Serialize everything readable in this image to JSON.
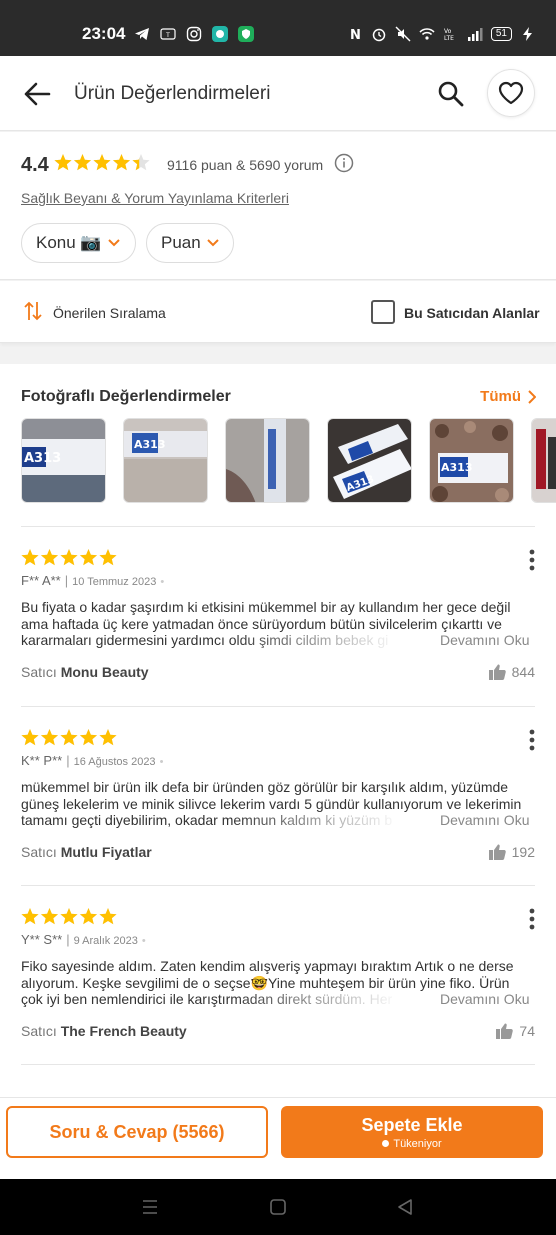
{
  "status_bar": {
    "time": "23:04",
    "battery": "51"
  },
  "header": {
    "title": "Ürün Değerlendirmeleri"
  },
  "summary": {
    "rating": "4.4",
    "rating_stars": 4.4,
    "counts": "9116 puan & 5690 yorum",
    "criteria_link": "Sağlık Beyanı & Yorum Yayınlama Kriterleri",
    "filters": [
      "Konu 📷",
      "Puan"
    ]
  },
  "sort": {
    "label": "Önerilen Sıralama",
    "seller_filter": "Bu Satıcıdan Alanlar",
    "seller_filter_checked": false
  },
  "photos": {
    "title": "Fotoğraflı Değerlendirmeler",
    "all_label": "Tümü"
  },
  "reviews": [
    {
      "stars": 5,
      "author": "F** A**",
      "date": "10 Temmuz 2023",
      "text": "Bu fiyata o kadar şaşırdım ki etkisini mükemmel bir ay kullandım her gece değil ama haftada üç kere yatmadan önce sürüyordum bütün sivilcelerim çıkarttı ve kararmaları gidermesini yardımcı oldu şimdi cildim bebek gi",
      "more": "Devamını Oku",
      "seller_prefix": "Satıcı",
      "seller": "Monu Beauty",
      "likes": "844"
    },
    {
      "stars": 5,
      "author": "K** P**",
      "date": "16 Ağustos 2023",
      "text": "mükemmel bir ürün ilk defa bir üründen göz görülür bir karşılık aldım, yüzümde güneş lekelerim ve minik silivce lekerim vardı 5 gündür kullanıyorum ve lekerimin tamamı geçti diyebilirim, okadar memnun kaldım ki yüzüm b",
      "more": "Devamını Oku",
      "seller_prefix": "Satıcı",
      "seller": "Mutlu Fiyatlar",
      "likes": "192"
    },
    {
      "stars": 5,
      "author": "Y** S**",
      "date": "9 Aralık 2023",
      "text": "Fiko sayesinde aldım. Zaten kendim alışveriş yapmayı bıraktım Artık o ne derse alıyorum. Keşke sevgilimi de o seçse🤓Yine muhteşem bir ürün yine fiko. Ürün çok iyi ben nemlendirici ile karıştırmadan direkt sürdüm. Her",
      "more": "Devamını Oku",
      "seller_prefix": "Satıcı",
      "seller": "The French Beauty",
      "likes": "74"
    }
  ],
  "bottom": {
    "qa_button": "Soru & Cevap (5566)",
    "cart_button": "Sepete Ekle",
    "cart_sub": "Tükeniyor"
  },
  "colors": {
    "accent": "#f27a1a",
    "star": "#ffc000"
  }
}
